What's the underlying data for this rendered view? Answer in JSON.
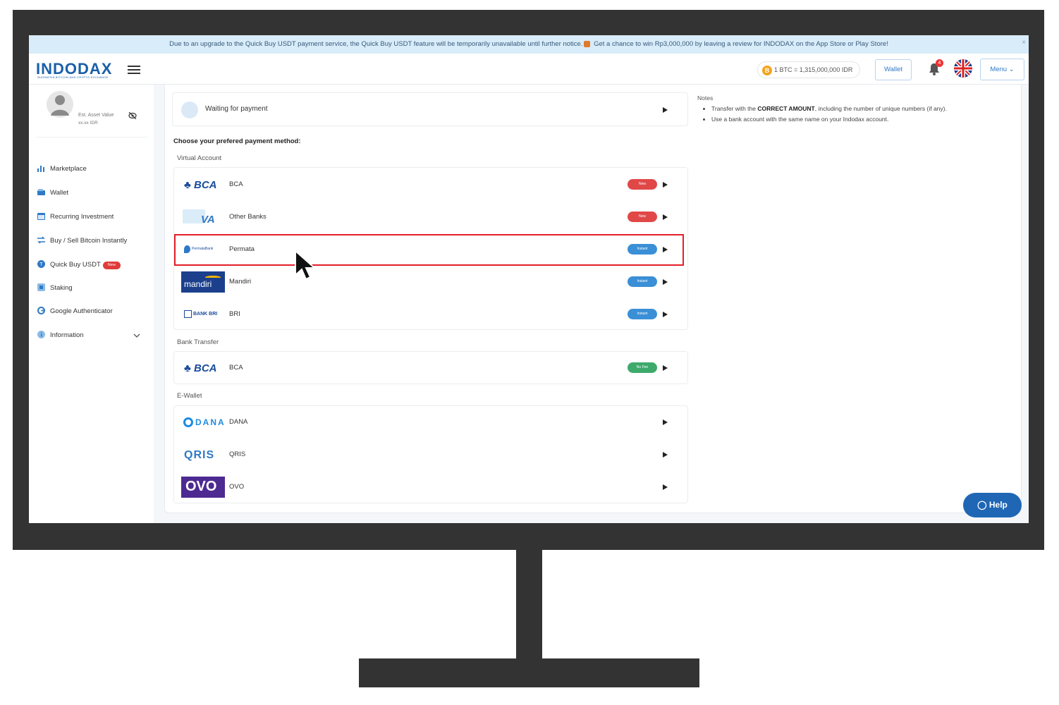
{
  "announcement": {
    "text_before": "Due to an upgrade to the Quick Buy USDT payment service, the Quick Buy USDT feature will be temporarily unavailable until further notice.",
    "text_after": "Get a chance to win Rp3,000,000 by leaving a review for INDODAX on the App Store or Play Store!",
    "close_label": "×"
  },
  "header": {
    "logo": "INDODAX",
    "logo_tagline": "INDONESIA BITCOIN AND CRYPTO EXCHANGE",
    "btc_rate": "1 BTC = 1,315,000,000 IDR",
    "wallet_label": "Wallet",
    "notification_count": "4",
    "menu_label": "Menu"
  },
  "sidebar": {
    "asset_label": "Est. Asset Value",
    "asset_value": "xx.xx IDR",
    "items": [
      {
        "label": "Marketplace",
        "icon": "chart-bar-icon"
      },
      {
        "label": "Wallet",
        "icon": "wallet-icon"
      },
      {
        "label": "Recurring Investment",
        "icon": "calendar-icon"
      },
      {
        "label": "Buy / Sell Bitcoin Instantly",
        "icon": "swap-icon"
      },
      {
        "label": "Quick Buy USDT",
        "icon": "usdt-icon",
        "badge": "New"
      },
      {
        "label": "Staking",
        "icon": "staking-icon"
      },
      {
        "label": "Google Authenticator",
        "icon": "google-icon"
      },
      {
        "label": "Information",
        "icon": "info-icon"
      }
    ]
  },
  "main": {
    "status": "Waiting for payment",
    "choose_title": "Choose your prefered payment method:",
    "sections": {
      "virtual_account": {
        "label": "Virtual Account",
        "rows": [
          {
            "logo": "BCA",
            "name": "BCA",
            "badge": "New",
            "badge_color": "#e04848"
          },
          {
            "logo": "VA",
            "name": "Other Banks",
            "badge": "New",
            "badge_color": "#e04848"
          },
          {
            "logo": "PermataBank",
            "name": "Permata",
            "badge": "Instant",
            "badge_color": "#3a8fd6"
          },
          {
            "logo": "mandiri",
            "name": "Mandiri",
            "badge": "Instant",
            "badge_color": "#3a8fd6"
          },
          {
            "logo": "BANK BRI",
            "name": "BRI",
            "badge": "Instant",
            "badge_color": "#3a8fd6"
          }
        ]
      },
      "bank_transfer": {
        "label": "Bank Transfer",
        "rows": [
          {
            "logo": "BCA",
            "name": "BCA",
            "badge": "No Fee",
            "badge_color": "#3daa6c"
          }
        ]
      },
      "ewallet": {
        "label": "E-Wallet",
        "rows": [
          {
            "logo": "DANA",
            "name": "DANA"
          },
          {
            "logo": "QRIS",
            "name": "QRIS"
          },
          {
            "logo": "OVO",
            "name": "OVO"
          }
        ]
      }
    },
    "notes": {
      "title": "Notes",
      "item1_pre": "Transfer with the ",
      "item1_bold": "CORRECT AMOUNT",
      "item1_post": ", including the number of unique numbers (if any).",
      "item2": "Use a bank account with the same name on your Indodax account."
    }
  },
  "help_label": "Help"
}
